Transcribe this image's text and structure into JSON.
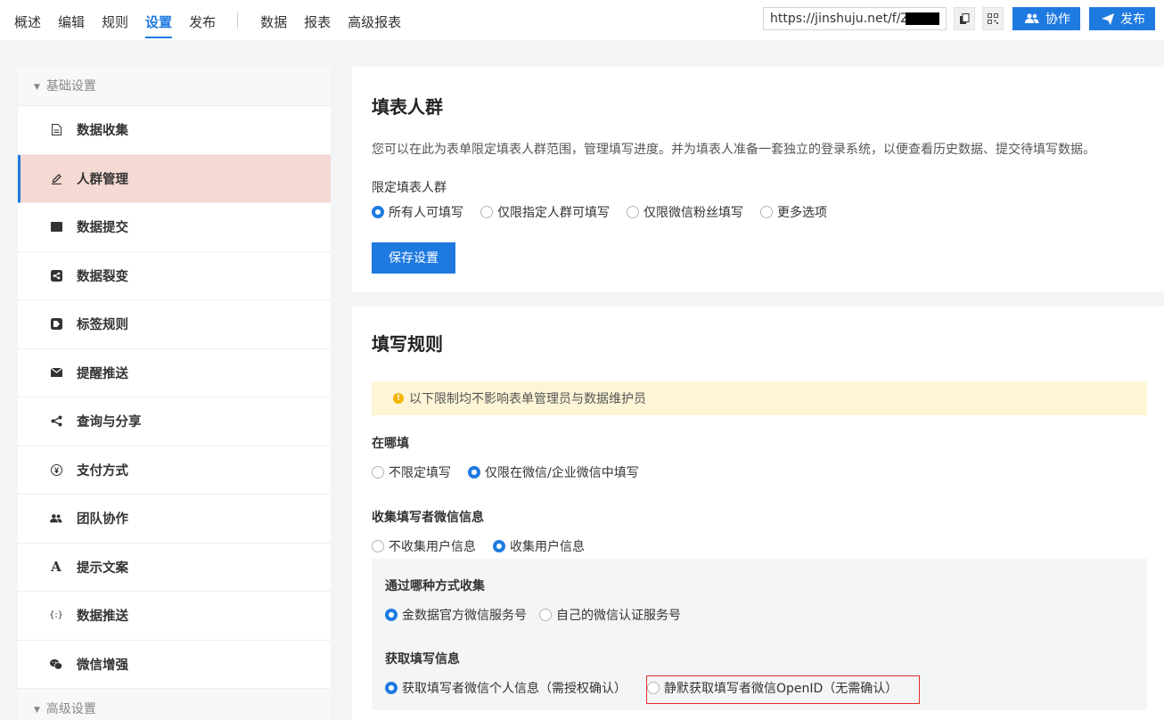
{
  "topbar": {
    "nav": [
      "概述",
      "编辑",
      "规则",
      "设置",
      "发布"
    ],
    "nav2": [
      "数据",
      "报表",
      "高级报表"
    ],
    "active": "设置",
    "url": "https://jinshuju.net/f/Z",
    "collab_label": "协作",
    "publish_label": "发布"
  },
  "sidebar": {
    "group_basic": "基础设置",
    "group_advanced": "高级设置",
    "items": [
      {
        "label": "数据收集",
        "icon": "document-icon"
      },
      {
        "label": "人群管理",
        "icon": "edit-icon"
      },
      {
        "label": "数据提交",
        "icon": "square-icon"
      },
      {
        "label": "数据裂变",
        "icon": "share-box-icon"
      },
      {
        "label": "标签规则",
        "icon": "tag-icon"
      },
      {
        "label": "提醒推送",
        "icon": "envelope-icon"
      },
      {
        "label": "查询与分享",
        "icon": "share-icon"
      },
      {
        "label": "支付方式",
        "icon": "yen-icon"
      },
      {
        "label": "团队协作",
        "icon": "users-icon"
      },
      {
        "label": "提示文案",
        "icon": "font-icon"
      },
      {
        "label": "数据推送",
        "icon": "code-icon"
      },
      {
        "label": "微信增强",
        "icon": "wechat-icon"
      }
    ],
    "active": "人群管理"
  },
  "crowd": {
    "title": "填表人群",
    "description": "您可以在此为表单限定填表人群范围，管理填写进度。并为填表人准备一套独立的登录系统，以便查看历史数据、提交待填写数据。",
    "limit_label": "限定填表人群",
    "options": [
      "所有人可填写",
      "仅限指定人群可填写",
      "仅限微信粉丝填写",
      "更多选项"
    ],
    "selected": "所有人可填写",
    "save_label": "保存设置"
  },
  "rules": {
    "title": "填写规则",
    "notice": "以下限制均不影响表单管理员与数据维护员",
    "where_label": "在哪填",
    "where_options": [
      "不限定填写",
      "仅限在微信/企业微信中填写"
    ],
    "where_selected": "仅限在微信/企业微信中填写",
    "collect_label": "收集填写者微信信息",
    "collect_options": [
      "不收集用户信息",
      "收集用户信息"
    ],
    "collect_selected": "收集用户信息",
    "method_label": "通过哪种方式收集",
    "method_options": [
      "金数据官方微信服务号",
      "自己的微信认证服务号"
    ],
    "method_selected": "金数据官方微信服务号",
    "fetch_label": "获取填写信息",
    "fetch_options": [
      "获取填写者微信个人信息（需授权确认）",
      "静默获取填写者微信OpenID（无需确认）"
    ],
    "fetch_selected": "获取填写者微信个人信息（需授权确认）"
  },
  "colors": {
    "accent": "#1f7ae0",
    "active_row": "#f5d9d3",
    "notice_bg": "#fdf5d6",
    "highlight_border": "#e0302c"
  }
}
